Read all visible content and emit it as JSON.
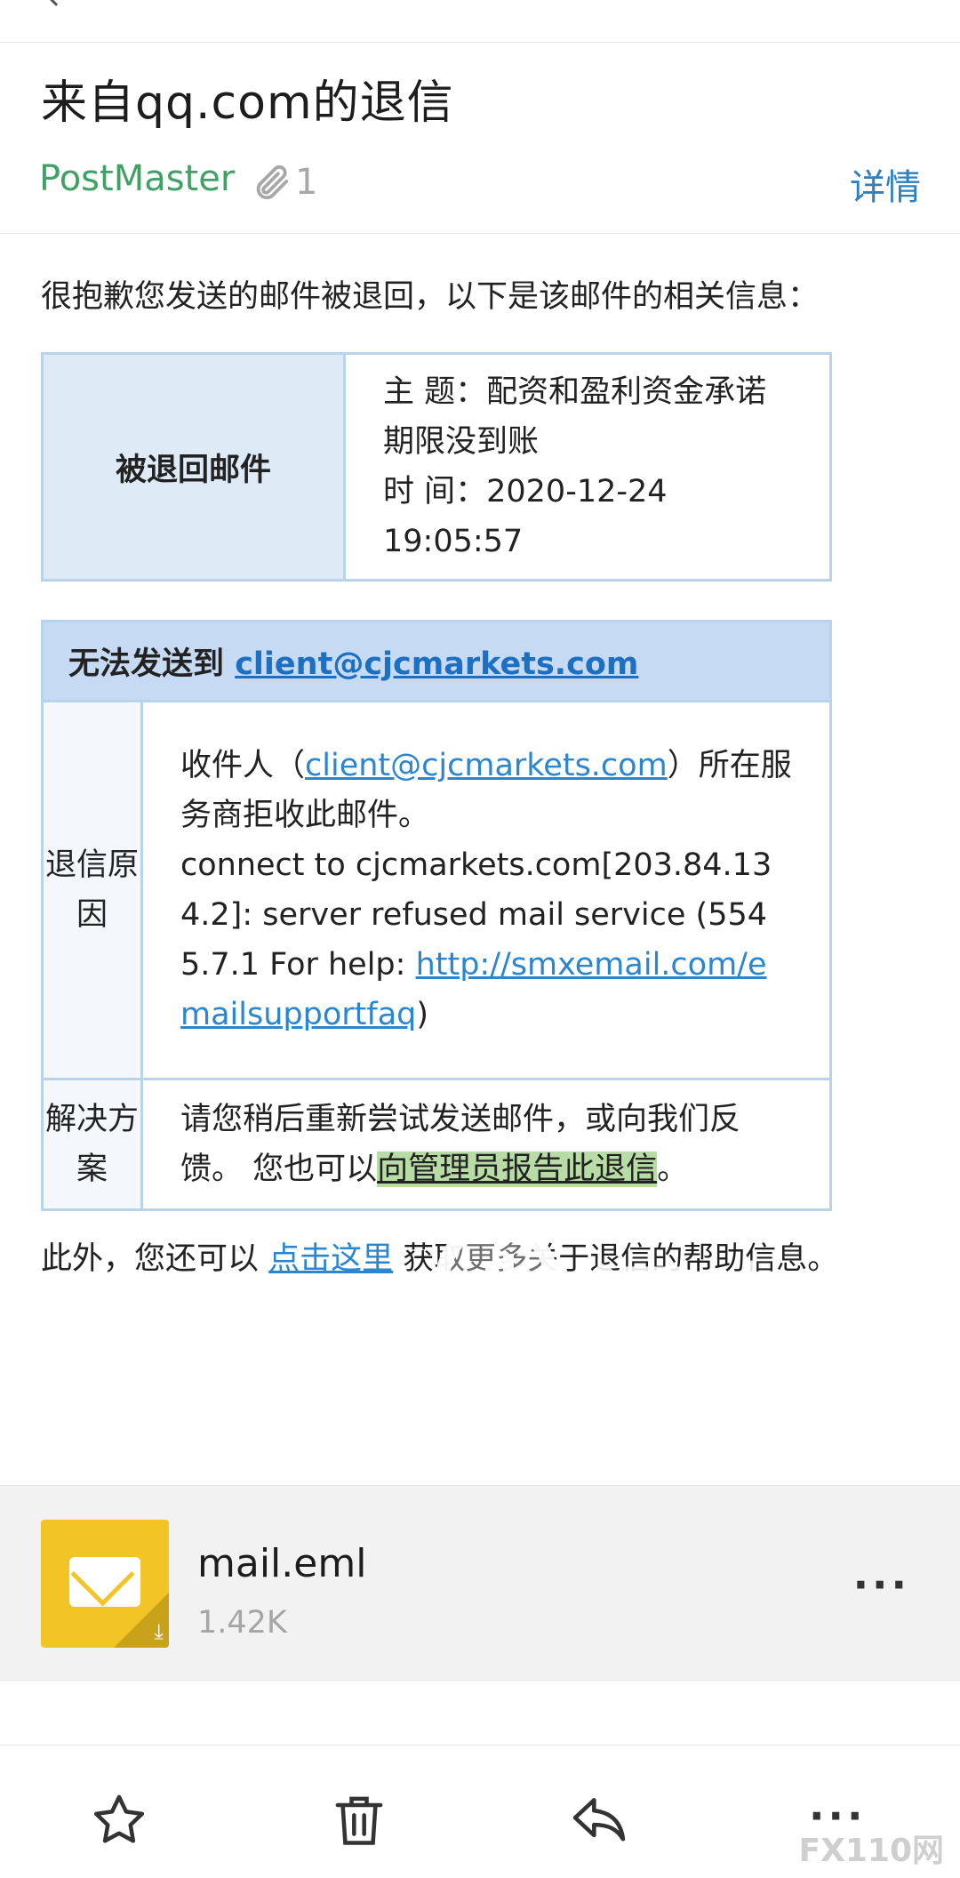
{
  "email": {
    "subject": "来自qq.com的退信",
    "sender": "PostMaster",
    "attachment_count": "1",
    "details_label": "详情",
    "intro": "很抱歉您发送的邮件被退回，以下是该邮件的相关信息："
  },
  "returned_mail": {
    "label": "被退回邮件",
    "subject_line": "主 题：配资和盈利资金承诺期限没到账",
    "time_line": "时 间：2020-12-24 19:05:57"
  },
  "failure": {
    "header_prefix": "无法发送到 ",
    "recipient": "client@cjcmarkets.com",
    "reason_label": "退信原因",
    "reason_text_1": "收件人（",
    "reason_recipient": "client@cjcmarkets.com",
    "reason_text_2": "）所在服务商拒收此邮件。",
    "reason_detail": "connect to cjcmarkets.com[203.84.134.2]: server refused mail service (554 5.7.1 For help: ",
    "help_link": "http://smxemail.com/emailsupportfaq",
    "reason_close": ")",
    "solution_label": "解决方案",
    "solution_text": "请您稍后重新尝试发送邮件，或向我们反馈。 您也可以",
    "solution_link": "向管理员报告此退信",
    "solution_end": "。"
  },
  "extra": {
    "prefix": "此外，您还可以 ",
    "link": "点击这里",
    "suffix": " 获取更多关于退信的帮助信息。"
  },
  "watermark": {
    "text": "汇查查"
  },
  "attachment": {
    "name": "mail.eml",
    "size": "1.42K",
    "more": "···"
  },
  "toolbar": {
    "more": "···"
  },
  "corner_logo": "FX110网",
  "colors": {
    "sender_green": "#3fa165",
    "link_blue": "#2b86cf",
    "table_border": "#b9d3ea",
    "table_header_bg": "#c6dbf3",
    "highlight_green": "#b8dca5",
    "file_icon_yellow": "#f3c425"
  },
  "icons": {
    "attachment": "paperclip-icon",
    "file": "envelope-file-icon",
    "star": "star-icon",
    "trash": "trash-icon",
    "reply": "reply-icon",
    "more": "more-dots-icon"
  }
}
